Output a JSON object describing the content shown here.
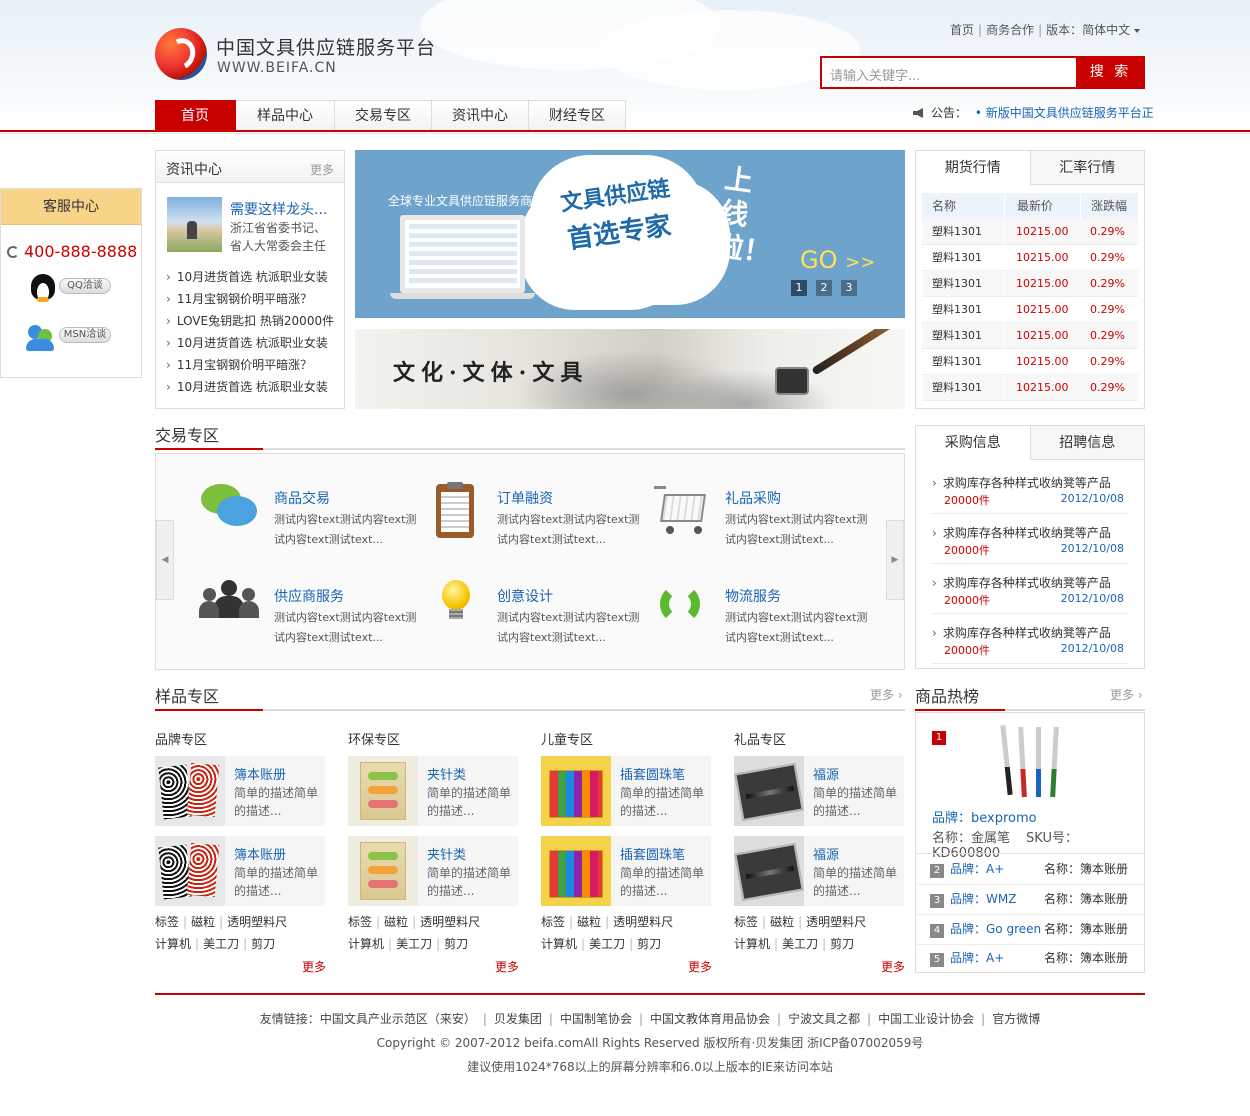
{
  "header": {
    "site_title": "中国文具供应链服务平台",
    "site_url": "WWW.BEIFA.CN",
    "toplinks": [
      "首页",
      "商务合作",
      "版本：简体中文"
    ],
    "search_placeholder": "请输入关键字...",
    "search_button": "搜 索",
    "notice_label": "公告：",
    "notice_text": "新版中国文具供应链服务平台正"
  },
  "nav": [
    "首页",
    "样品中心",
    "交易专区",
    "资讯中心",
    "财经专区"
  ],
  "service": {
    "title": "客服中心",
    "phone": "400-888-8888",
    "qq": "QQ洽谈",
    "msn": "MSN洽谈"
  },
  "news": {
    "title": "资讯中心",
    "more": "更多",
    "headline": "需要这样龙头...",
    "headline_desc": "浙江省省委书记、省人大常委会主任",
    "items": [
      "10月进货首选 杭派职业女装",
      "11月宝钢钢价明平暗涨？",
      "LOVE兔钥匙扣 热销20000件",
      "10月进货首选 杭派职业女装",
      "11月宝钢钢价明平暗涨？",
      "10月进货首选 杭派职业女装"
    ]
  },
  "banner": {
    "tagline": "全球专业文具供应链服务商！",
    "line1": "文具供应链",
    "line2": "首选专家",
    "online": "上线啦！",
    "go": "GO",
    "go_arrow": ">>",
    "pages": [
      "1",
      "2",
      "3"
    ]
  },
  "ink_banner": {
    "text": "文化·文体·文具"
  },
  "market": {
    "tabs": [
      "期货行情",
      "汇率行情"
    ],
    "columns": [
      "名称",
      "最新价",
      "涨跌幅"
    ],
    "rows": [
      [
        "塑料1301",
        "10215.00",
        "0.29%"
      ],
      [
        "塑料1301",
        "10215.00",
        "0.29%"
      ],
      [
        "塑料1301",
        "10215.00",
        "0.29%"
      ],
      [
        "塑料1301",
        "10215.00",
        "0.29%"
      ],
      [
        "塑料1301",
        "10215.00",
        "0.29%"
      ],
      [
        "塑料1301",
        "10215.00",
        "0.29%"
      ],
      [
        "塑料1301",
        "10215.00",
        "0.29%"
      ]
    ]
  },
  "trade": {
    "title": "交易专区",
    "items": [
      {
        "name": "商品交易",
        "desc": "测试内容text测试内容text测试内容text测试text..."
      },
      {
        "name": "订单融资",
        "desc": "测试内容text测试内容text测试内容text测试text..."
      },
      {
        "name": "礼品采购",
        "desc": "测试内容text测试内容text测试内容text测试text..."
      },
      {
        "name": "供应商服务",
        "desc": "测试内容text测试内容text测试内容text测试text..."
      },
      {
        "name": "创意设计",
        "desc": "测试内容text测试内容text测试内容text测试text..."
      },
      {
        "name": "物流服务",
        "desc": "测试内容text测试内容text测试内容text测试text..."
      }
    ]
  },
  "purchase": {
    "tabs": [
      "采购信息",
      "招聘信息"
    ],
    "items": [
      {
        "title": "求购库存各种样式收纳凳等产品",
        "qty": "20000件",
        "date": "2012/10/08"
      },
      {
        "title": "求购库存各种样式收纳凳等产品",
        "qty": "20000件",
        "date": "2012/10/08"
      },
      {
        "title": "求购库存各种样式收纳凳等产品",
        "qty": "20000件",
        "date": "2012/10/08"
      },
      {
        "title": "求购库存各种样式收纳凳等产品",
        "qty": "20000件",
        "date": "2012/10/08"
      }
    ]
  },
  "samples": {
    "title": "样品专区",
    "more": "更多",
    "categories": [
      {
        "name": "品牌专区",
        "product": "簿本账册",
        "desc": "简单的描述简单的描述...",
        "more": "更多"
      },
      {
        "name": "环保专区",
        "product": "夹针类",
        "desc": "简单的描述简单的描述...",
        "more": "更多"
      },
      {
        "name": "儿童专区",
        "product": "插套圆珠笔",
        "desc": "简单的描述简单的描述...",
        "more": "更多"
      },
      {
        "name": "礼品专区",
        "product": "福源",
        "desc": "简单的描述简单的描述...",
        "more": "更多"
      }
    ],
    "tags_row1": [
      "标签",
      "磁粒",
      "透明塑料尺"
    ],
    "tags_row2": [
      "计算机",
      "美工刀",
      "剪刀"
    ]
  },
  "hot": {
    "title": "商品热榜",
    "more": "更多",
    "top": {
      "rank": "1",
      "brand": "品牌：bexpromo",
      "name": "名称：金属笔",
      "sku": "SKU号：KD600800"
    },
    "items": [
      {
        "rank": "2",
        "brand": "品牌：A+",
        "name": "名称：簿本账册"
      },
      {
        "rank": "3",
        "brand": "品牌：WMZ",
        "name": "名称：簿本账册"
      },
      {
        "rank": "4",
        "brand": "品牌：Go green",
        "name": "名称：簿本账册"
      },
      {
        "rank": "5",
        "brand": "品牌：A+",
        "name": "名称：簿本账册"
      }
    ]
  },
  "footer": {
    "links_label": "友情链接：",
    "links": [
      "中国文具产业示范区（来安）",
      "贝发集团",
      "中国制笔协会",
      "中国文教体育用品协会",
      "宁波文具之都",
      "中国工业设计协会",
      "官方微博"
    ],
    "copyright": "Copyright © 2007-2012 beifa.comAll Rights Reserved 版权所有·贝发集团 浙ICP备07002059号",
    "recommend": "建议使用1024*768以上的屏幕分辨率和6.0以上版本的IE来访问本站"
  }
}
